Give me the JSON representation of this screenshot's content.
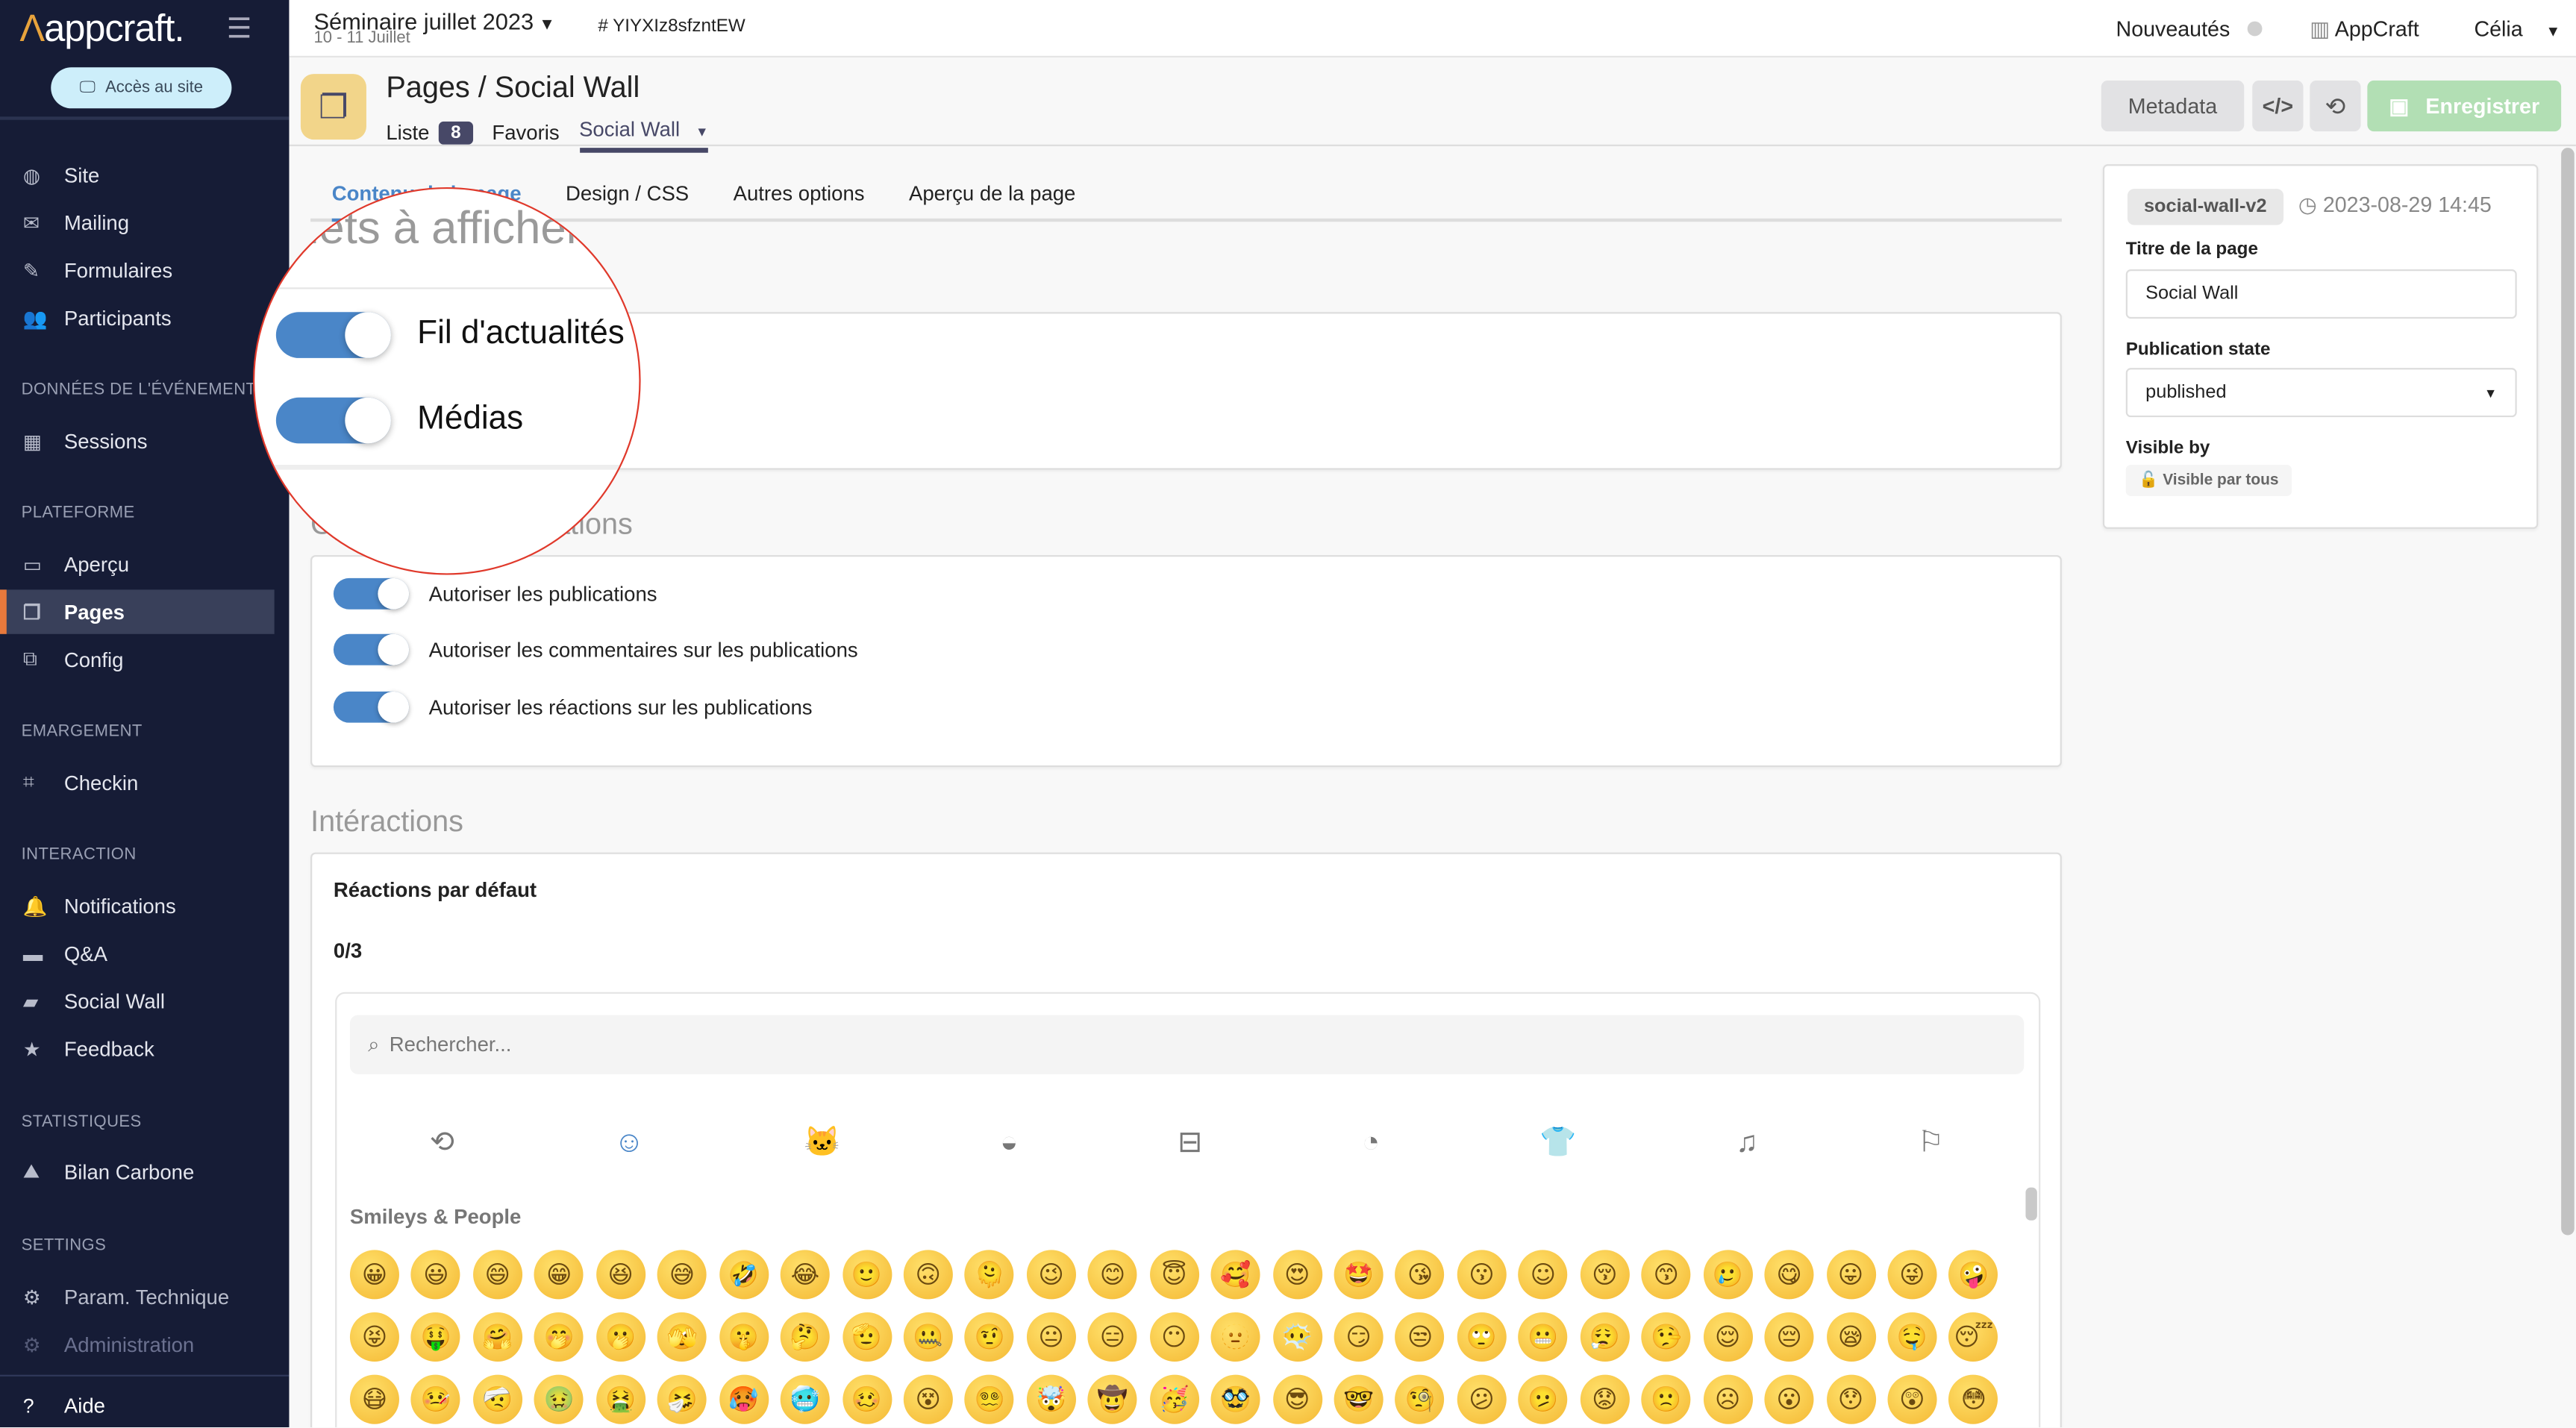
{
  "brand": {
    "logo_mark": "Λ",
    "logo_text": "appcraft."
  },
  "sidebar": {
    "site_button": "Accès au site",
    "sections": [
      {
        "title": "DONNÉES DE L'ÉVÉNEMENT"
      },
      {
        "title": "PLATEFORME"
      },
      {
        "title": "EMARGEMENT"
      },
      {
        "title": "INTERACTION"
      },
      {
        "title": "STATISTIQUES"
      },
      {
        "title": "SETTINGS"
      }
    ],
    "items": [
      {
        "label": "Site",
        "icon": "globe-icon"
      },
      {
        "label": "Mailing",
        "icon": "mail-icon"
      },
      {
        "label": "Formulaires",
        "icon": "pen-icon"
      },
      {
        "label": "Participants",
        "icon": "users-icon"
      },
      {
        "label": "Sessions",
        "icon": "calendar-icon"
      },
      {
        "label": "Aperçu",
        "icon": "laptop-icon"
      },
      {
        "label": "Pages",
        "icon": "pages-icon",
        "active": true
      },
      {
        "label": "Config",
        "icon": "config-icon"
      },
      {
        "label": "Checkin",
        "icon": "qr-icon"
      },
      {
        "label": "Notifications",
        "icon": "bell-icon"
      },
      {
        "label": "Q&A",
        "icon": "comments-icon"
      },
      {
        "label": "Social Wall",
        "icon": "image-icon"
      },
      {
        "label": "Feedback",
        "icon": "star-icon"
      },
      {
        "label": "Bilan Carbone",
        "icon": "landscape-icon"
      },
      {
        "label": "Param. Technique",
        "icon": "cog-box-icon"
      },
      {
        "label": "Administration",
        "icon": "cog-icon",
        "disabled": true
      }
    ],
    "help": "Aide"
  },
  "topbar": {
    "event_title": "Séminaire juillet 2023",
    "event_dates": "10 - 11 Juillet",
    "event_id": "# YIYXIz8sfzntEW",
    "news": "Nouveautés",
    "org": "AppCraft",
    "user": "Célia"
  },
  "header": {
    "title": "Pages / Social Wall",
    "nav": {
      "list": "Liste",
      "count": "8",
      "favorites": "Favoris",
      "current": "Social Wall"
    },
    "buttons": {
      "metadata": "Metadata",
      "code": "</>",
      "history": "⟲",
      "save": "Enregistrer"
    }
  },
  "tabs": [
    {
      "label": "Contenu de la page",
      "active": true
    },
    {
      "label": "Design / CSS"
    },
    {
      "label": "Autres options"
    },
    {
      "label": "Aperçu de la page"
    }
  ],
  "main": {
    "tabs_section": {
      "title": "Onglets à afficher",
      "toggles": [
        {
          "label": "Fil d'actualités",
          "on": true
        },
        {
          "label": "Médias",
          "on": true
        }
      ]
    },
    "publications_section": {
      "title": "Options des publications",
      "toggles": [
        {
          "label": "Autoriser les publications",
          "on": true
        },
        {
          "label": "Autoriser les commentaires sur les publications",
          "on": true
        },
        {
          "label": "Autoriser les réactions sur les publications",
          "on": true
        }
      ]
    },
    "interactions": {
      "title": "Intéractions",
      "reactions_label": "Réactions par défaut",
      "count": "0/3",
      "picker": {
        "search_placeholder": "Rechercher...",
        "categories": [
          "clock-icon",
          "smiley-icon",
          "cat-icon",
          "burger-icon",
          "bus-icon",
          "ball-icon",
          "shirt-icon",
          "music-icon",
          "flag-icon"
        ],
        "active_category": "smiley-icon",
        "group": "Smileys & People",
        "emojis": [
          "😀",
          "😃",
          "😄",
          "😁",
          "😆",
          "😅",
          "🤣",
          "😂",
          "🙂",
          "🙃",
          "🫠",
          "😉",
          "😊",
          "😇",
          "🥰",
          "😍",
          "🤩",
          "😘",
          "😗",
          "☺",
          "😚",
          "😙",
          "🥲",
          "😋",
          "😛",
          "😜",
          "🤪",
          "😝",
          "🤑",
          "🤗",
          "🤭",
          "🫢",
          "🫣",
          "🤫",
          "🤔",
          "🫡",
          "🤐",
          "🤨",
          "😐",
          "😑",
          "😶",
          "🫥",
          "😶‍🌫️",
          "😏",
          "😒",
          "🙄",
          "😬",
          "😮‍💨",
          "🤥",
          "😌",
          "😔",
          "😪",
          "🤤",
          "😴",
          "😷",
          "🤒",
          "🤕",
          "🤢",
          "🤮",
          "🤧",
          "🥵",
          "🥶",
          "🥴",
          "😵",
          "😵‍💫",
          "🤯",
          "🤠",
          "🥳",
          "🥸",
          "😎",
          "🤓",
          "🧐",
          "😕",
          "🫤",
          "😟",
          "🙁",
          "☹",
          "😮",
          "😯",
          "😲",
          "😳"
        ]
      }
    }
  },
  "right_panel": {
    "slug": "social-wall-v2",
    "updated": "2023-08-29 14:45",
    "title_label": "Titre de la page",
    "title_value": "Social Wall",
    "state_label": "Publication state",
    "state_value": "published",
    "visible_label": "Visible by",
    "visible_value": "Visible par tous"
  },
  "colors": {
    "sidebar": "#161c36",
    "accent": "#4a86c8",
    "active_marker": "#e8793c",
    "save": "#b2dfb4",
    "page_icon_bg": "#f2d58a",
    "magnifier": "#e0392b"
  }
}
